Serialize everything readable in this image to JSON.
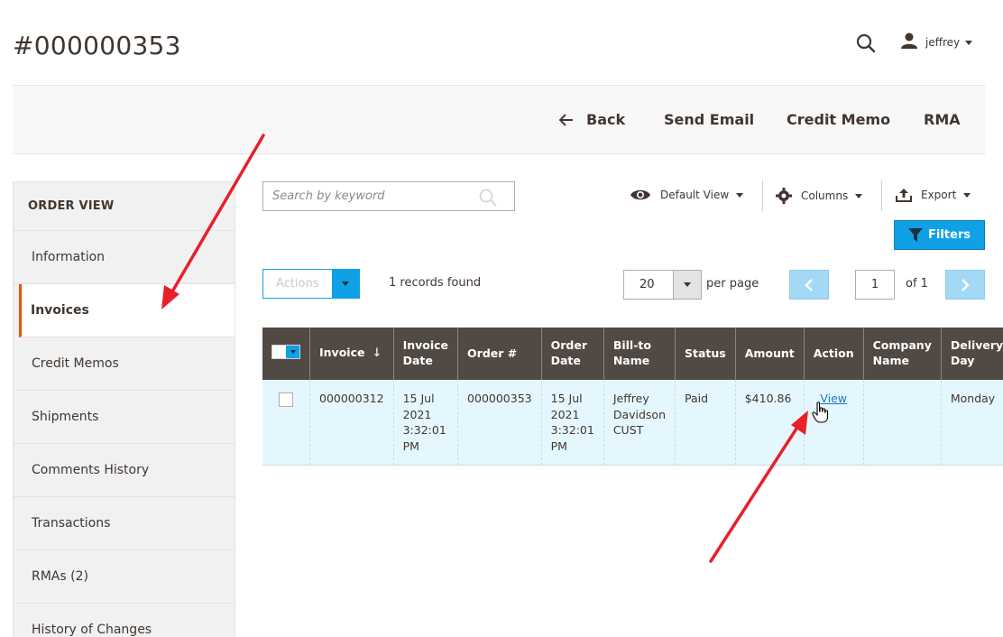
{
  "page": {
    "title": "#000000353"
  },
  "header": {
    "username": "jeffrey"
  },
  "toolbar": {
    "back_label": "Back",
    "send_email_label": "Send Email",
    "credit_memo_label": "Credit Memo",
    "rma_label": "RMA"
  },
  "sidebar": {
    "heading": "ORDER VIEW",
    "items": [
      {
        "label": "Information"
      },
      {
        "label": "Invoices",
        "active": true
      },
      {
        "label": "Credit Memos"
      },
      {
        "label": "Shipments"
      },
      {
        "label": "Comments History"
      },
      {
        "label": "Transactions"
      },
      {
        "label": "RMAs (2)"
      },
      {
        "label": "History of Changes"
      }
    ]
  },
  "grid": {
    "search_placeholder": "Search by keyword",
    "view_label": "Default View",
    "columns_label": "Columns",
    "export_label": "Export",
    "filters_label": "Filters",
    "actions_label": "Actions",
    "records_found": "1 records found",
    "per_page_value": "20",
    "per_page_label": "per page",
    "current_page": "1",
    "page_of": "of 1",
    "headers": [
      "Invoice",
      "Invoice Date",
      "Order #",
      "Order Date",
      "Bill-to Name",
      "Status",
      "Amount",
      "Action",
      "Company Name",
      "Delivery Day"
    ],
    "rows": [
      {
        "invoice": "000000312",
        "invoice_date": "15 Jul 2021 3:32:01 PM",
        "order": "000000353",
        "order_date": "15 Jul 2021 3:32:01 PM",
        "bill_to": "Jeffrey Davidson CUST",
        "status": "Paid",
        "amount": "$410.86",
        "action": "View",
        "company": "",
        "delivery_day": "Monday"
      }
    ]
  },
  "colors": {
    "accent_orange": "#eb5202",
    "header_dark": "#514943",
    "primary_blue": "#0fa0e6",
    "row_highlight": "#e5f7fe",
    "annotation_red": "#e8202a"
  },
  "icons": [
    "search-icon",
    "user-icon",
    "back-arrow-icon",
    "eye-icon",
    "gear-icon",
    "export-icon",
    "filter-icon",
    "chevron-left-icon",
    "chevron-right-icon",
    "hand-cursor-icon",
    "sort-arrow-icon"
  ]
}
